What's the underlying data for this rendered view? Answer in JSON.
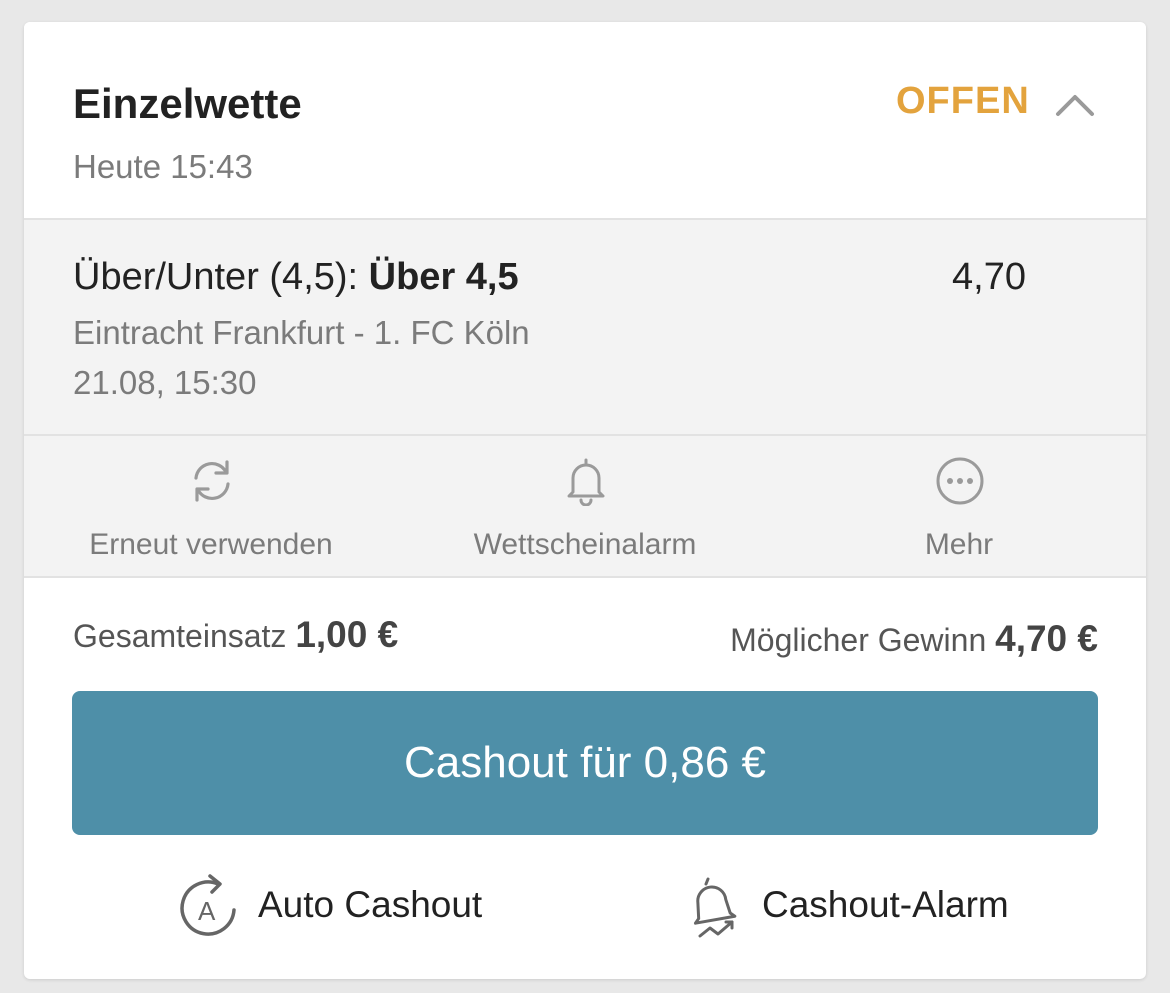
{
  "header": {
    "title": "Einzelwette",
    "time": "Heute 15:43",
    "status": "OFFEN"
  },
  "selection": {
    "market_prefix": "Über/Unter (4,5): ",
    "market_pick": "Über 4,5",
    "odds": "4,70",
    "event": "Eintracht Frankfurt - 1. FC Köln",
    "date": "21.08, 15:30"
  },
  "actions": [
    {
      "label": "Erneut verwenden",
      "icon": "refresh-icon"
    },
    {
      "label": "Wettscheinalarm",
      "icon": "bell-icon"
    },
    {
      "label": "Mehr",
      "icon": "more-icon"
    }
  ],
  "summary": {
    "stake_label": "Gesamteinsatz ",
    "stake_value": "1,00 €",
    "win_label": "Möglicher Gewinn ",
    "win_value": "4,70 €"
  },
  "cashout": {
    "button_label": "Cashout für 0,86 €",
    "auto_label": "Auto Cashout",
    "alarm_label": "Cashout-Alarm"
  },
  "colors": {
    "status": "#e3a33d",
    "cashout_button": "#4e8fa8"
  }
}
